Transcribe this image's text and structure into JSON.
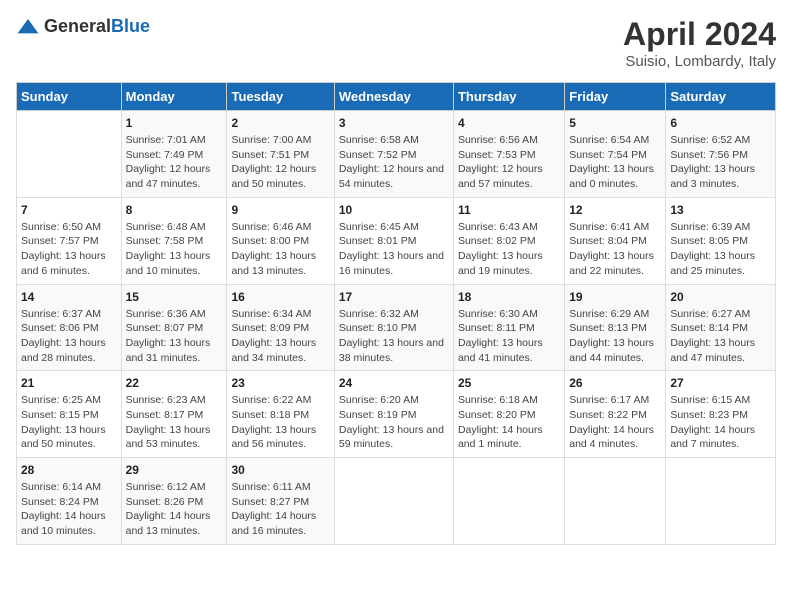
{
  "header": {
    "logo_general": "General",
    "logo_blue": "Blue",
    "title": "April 2024",
    "location": "Suisio, Lombardy, Italy"
  },
  "days_of_week": [
    "Sunday",
    "Monday",
    "Tuesday",
    "Wednesday",
    "Thursday",
    "Friday",
    "Saturday"
  ],
  "weeks": [
    [
      {
        "day": "",
        "sunrise": "",
        "sunset": "",
        "daylight": ""
      },
      {
        "day": "1",
        "sunrise": "Sunrise: 7:01 AM",
        "sunset": "Sunset: 7:49 PM",
        "daylight": "Daylight: 12 hours and 47 minutes."
      },
      {
        "day": "2",
        "sunrise": "Sunrise: 7:00 AM",
        "sunset": "Sunset: 7:51 PM",
        "daylight": "Daylight: 12 hours and 50 minutes."
      },
      {
        "day": "3",
        "sunrise": "Sunrise: 6:58 AM",
        "sunset": "Sunset: 7:52 PM",
        "daylight": "Daylight: 12 hours and 54 minutes."
      },
      {
        "day": "4",
        "sunrise": "Sunrise: 6:56 AM",
        "sunset": "Sunset: 7:53 PM",
        "daylight": "Daylight: 12 hours and 57 minutes."
      },
      {
        "day": "5",
        "sunrise": "Sunrise: 6:54 AM",
        "sunset": "Sunset: 7:54 PM",
        "daylight": "Daylight: 13 hours and 0 minutes."
      },
      {
        "day": "6",
        "sunrise": "Sunrise: 6:52 AM",
        "sunset": "Sunset: 7:56 PM",
        "daylight": "Daylight: 13 hours and 3 minutes."
      }
    ],
    [
      {
        "day": "7",
        "sunrise": "Sunrise: 6:50 AM",
        "sunset": "Sunset: 7:57 PM",
        "daylight": "Daylight: 13 hours and 6 minutes."
      },
      {
        "day": "8",
        "sunrise": "Sunrise: 6:48 AM",
        "sunset": "Sunset: 7:58 PM",
        "daylight": "Daylight: 13 hours and 10 minutes."
      },
      {
        "day": "9",
        "sunrise": "Sunrise: 6:46 AM",
        "sunset": "Sunset: 8:00 PM",
        "daylight": "Daylight: 13 hours and 13 minutes."
      },
      {
        "day": "10",
        "sunrise": "Sunrise: 6:45 AM",
        "sunset": "Sunset: 8:01 PM",
        "daylight": "Daylight: 13 hours and 16 minutes."
      },
      {
        "day": "11",
        "sunrise": "Sunrise: 6:43 AM",
        "sunset": "Sunset: 8:02 PM",
        "daylight": "Daylight: 13 hours and 19 minutes."
      },
      {
        "day": "12",
        "sunrise": "Sunrise: 6:41 AM",
        "sunset": "Sunset: 8:04 PM",
        "daylight": "Daylight: 13 hours and 22 minutes."
      },
      {
        "day": "13",
        "sunrise": "Sunrise: 6:39 AM",
        "sunset": "Sunset: 8:05 PM",
        "daylight": "Daylight: 13 hours and 25 minutes."
      }
    ],
    [
      {
        "day": "14",
        "sunrise": "Sunrise: 6:37 AM",
        "sunset": "Sunset: 8:06 PM",
        "daylight": "Daylight: 13 hours and 28 minutes."
      },
      {
        "day": "15",
        "sunrise": "Sunrise: 6:36 AM",
        "sunset": "Sunset: 8:07 PM",
        "daylight": "Daylight: 13 hours and 31 minutes."
      },
      {
        "day": "16",
        "sunrise": "Sunrise: 6:34 AM",
        "sunset": "Sunset: 8:09 PM",
        "daylight": "Daylight: 13 hours and 34 minutes."
      },
      {
        "day": "17",
        "sunrise": "Sunrise: 6:32 AM",
        "sunset": "Sunset: 8:10 PM",
        "daylight": "Daylight: 13 hours and 38 minutes."
      },
      {
        "day": "18",
        "sunrise": "Sunrise: 6:30 AM",
        "sunset": "Sunset: 8:11 PM",
        "daylight": "Daylight: 13 hours and 41 minutes."
      },
      {
        "day": "19",
        "sunrise": "Sunrise: 6:29 AM",
        "sunset": "Sunset: 8:13 PM",
        "daylight": "Daylight: 13 hours and 44 minutes."
      },
      {
        "day": "20",
        "sunrise": "Sunrise: 6:27 AM",
        "sunset": "Sunset: 8:14 PM",
        "daylight": "Daylight: 13 hours and 47 minutes."
      }
    ],
    [
      {
        "day": "21",
        "sunrise": "Sunrise: 6:25 AM",
        "sunset": "Sunset: 8:15 PM",
        "daylight": "Daylight: 13 hours and 50 minutes."
      },
      {
        "day": "22",
        "sunrise": "Sunrise: 6:23 AM",
        "sunset": "Sunset: 8:17 PM",
        "daylight": "Daylight: 13 hours and 53 minutes."
      },
      {
        "day": "23",
        "sunrise": "Sunrise: 6:22 AM",
        "sunset": "Sunset: 8:18 PM",
        "daylight": "Daylight: 13 hours and 56 minutes."
      },
      {
        "day": "24",
        "sunrise": "Sunrise: 6:20 AM",
        "sunset": "Sunset: 8:19 PM",
        "daylight": "Daylight: 13 hours and 59 minutes."
      },
      {
        "day": "25",
        "sunrise": "Sunrise: 6:18 AM",
        "sunset": "Sunset: 8:20 PM",
        "daylight": "Daylight: 14 hours and 1 minute."
      },
      {
        "day": "26",
        "sunrise": "Sunrise: 6:17 AM",
        "sunset": "Sunset: 8:22 PM",
        "daylight": "Daylight: 14 hours and 4 minutes."
      },
      {
        "day": "27",
        "sunrise": "Sunrise: 6:15 AM",
        "sunset": "Sunset: 8:23 PM",
        "daylight": "Daylight: 14 hours and 7 minutes."
      }
    ],
    [
      {
        "day": "28",
        "sunrise": "Sunrise: 6:14 AM",
        "sunset": "Sunset: 8:24 PM",
        "daylight": "Daylight: 14 hours and 10 minutes."
      },
      {
        "day": "29",
        "sunrise": "Sunrise: 6:12 AM",
        "sunset": "Sunset: 8:26 PM",
        "daylight": "Daylight: 14 hours and 13 minutes."
      },
      {
        "day": "30",
        "sunrise": "Sunrise: 6:11 AM",
        "sunset": "Sunset: 8:27 PM",
        "daylight": "Daylight: 14 hours and 16 minutes."
      },
      {
        "day": "",
        "sunrise": "",
        "sunset": "",
        "daylight": ""
      },
      {
        "day": "",
        "sunrise": "",
        "sunset": "",
        "daylight": ""
      },
      {
        "day": "",
        "sunrise": "",
        "sunset": "",
        "daylight": ""
      },
      {
        "day": "",
        "sunrise": "",
        "sunset": "",
        "daylight": ""
      }
    ]
  ]
}
